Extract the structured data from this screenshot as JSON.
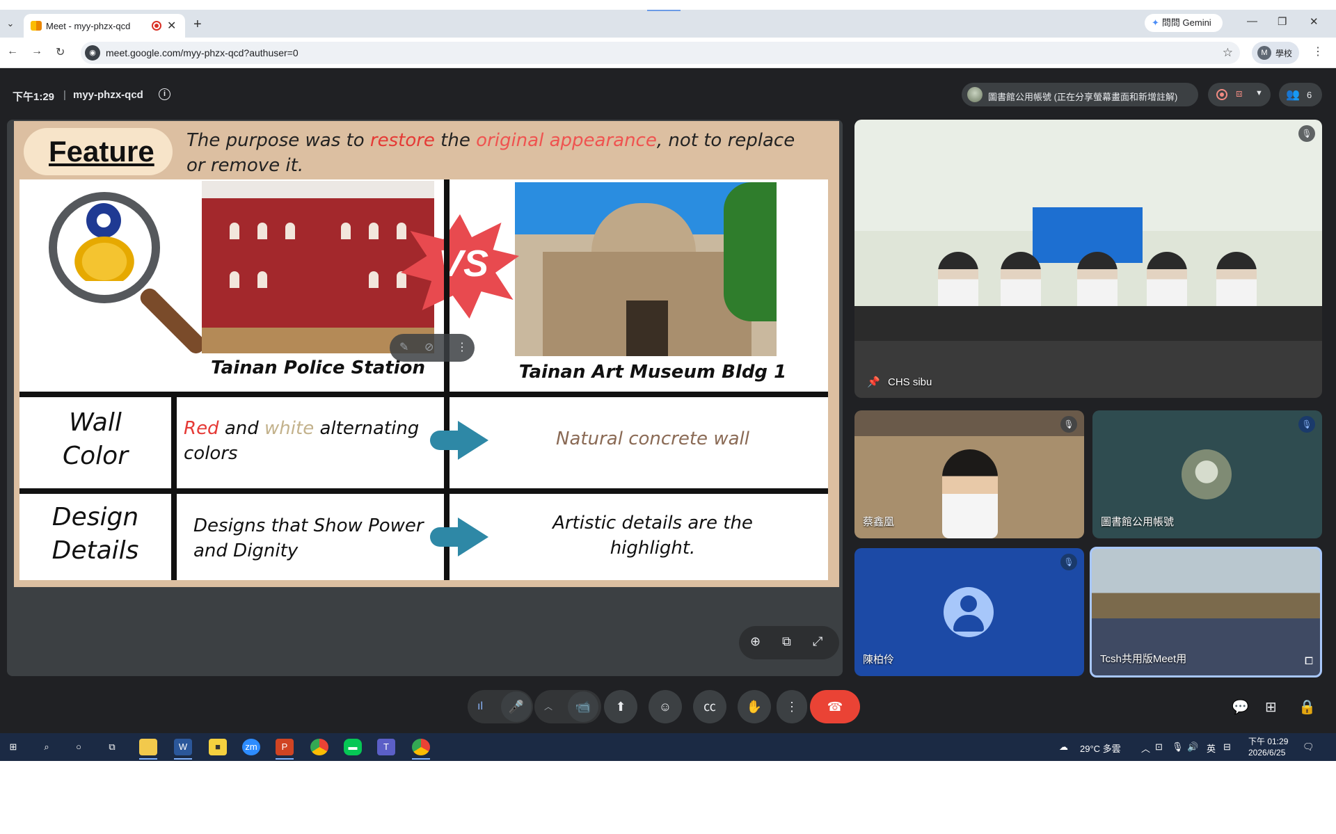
{
  "browser": {
    "tab": {
      "title": "Meet - myy-phzx-qcd"
    },
    "new_tab_label": "+",
    "gemini_label": "問問 Gemini",
    "url": "meet.google.com/myy-phzx-qcd?authuser=0",
    "profile": {
      "initial": "M",
      "label": "學校"
    }
  },
  "meet": {
    "time": "下午1:29",
    "separator": "|",
    "meeting_code": "myy-phzx-qcd",
    "presenting_text": "圖書館公用帳號 (正在分享螢幕畫面和新增註解)",
    "participant_count": "6"
  },
  "slide": {
    "feature_title": "Feature",
    "purpose": {
      "p1": "The purpose was to ",
      "restore": "restore",
      "p2": " the ",
      "original": "original appearance",
      "p3": ", not to replace or remove it."
    },
    "vs": "VS",
    "left_caption": "Tainan Police Station",
    "right_caption": "Tainan Art Museum Bldg 1",
    "rows": [
      {
        "title_line1": "Wall",
        "title_line2": "Color",
        "left_red": "Red",
        "left_and": " and ",
        "left_white": "white",
        "left_rest": " alternating colors",
        "right": "Natural concrete wall"
      },
      {
        "title_line1": "Design",
        "title_line2": "Details",
        "left": "Designs that Show Power and Dignity",
        "right": "Artistic details are the highlight."
      }
    ]
  },
  "participants": [
    {
      "name": "CHS sibu",
      "pinned": true
    },
    {
      "name": "蔡鑫凰"
    },
    {
      "name": "圖書館公用帳號"
    },
    {
      "name": "陳柏伶"
    },
    {
      "name": "Tcsh共用版Meet用"
    }
  ],
  "taskbar": {
    "weather": "29°C 多雲",
    "ime": "英",
    "clock_time": "下午 01:29",
    "clock_date": "2026/6/25"
  },
  "colors": {
    "meet_bg": "#202124",
    "end_call": "#ea4335",
    "slide_accent_red": "#e53935",
    "arrow_teal": "#2e88a6"
  }
}
